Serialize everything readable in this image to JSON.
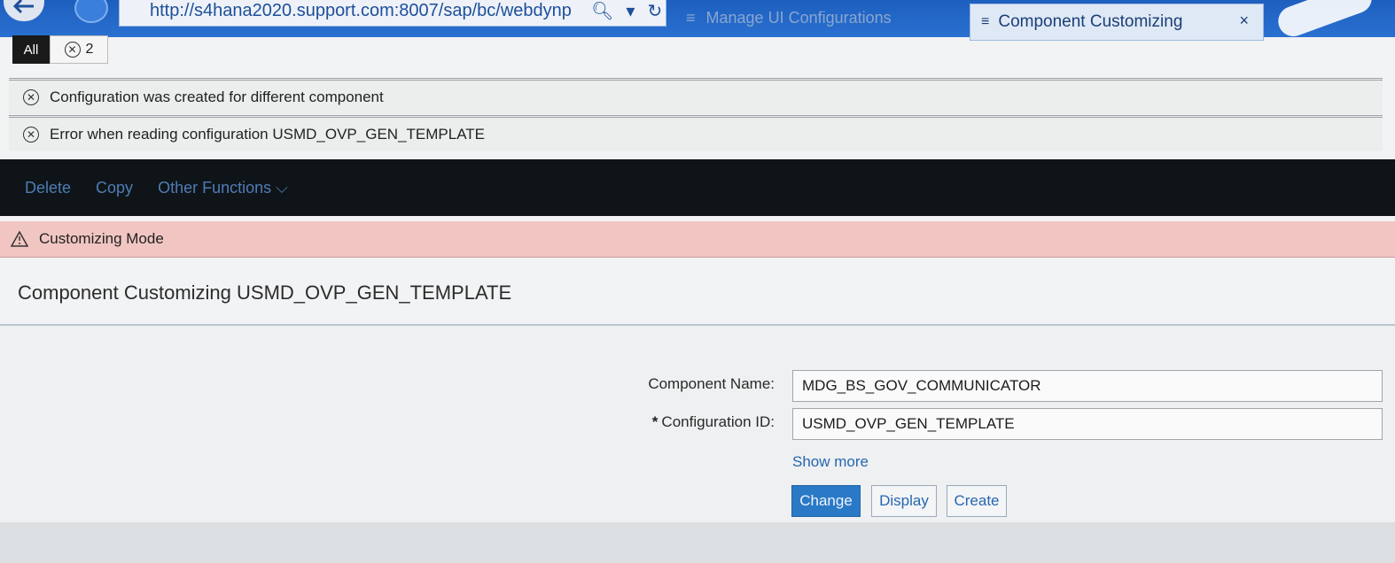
{
  "browser": {
    "address": "http://s4hana2020.support.com:8007/sap/bc/webdynp",
    "inactive_tab": "Manage UI Configurations",
    "active_tab": "Component Customizing",
    "active_tab_close": "×"
  },
  "messages": {
    "filter_all": "All",
    "error_count": "2",
    "items": [
      {
        "text": "Configuration was created for different component"
      },
      {
        "text": "Error when reading configuration USMD_OVP_GEN_TEMPLATE"
      }
    ]
  },
  "toolbar": {
    "delete_label": "Delete",
    "copy_label": "Copy",
    "other_functions_label": "Other Functions"
  },
  "mode_banner": {
    "text": "Customizing Mode"
  },
  "page": {
    "title": "Component Customizing USMD_OVP_GEN_TEMPLATE"
  },
  "form": {
    "component_name_label": "Component Name:",
    "component_name_value": "MDG_BS_GOV_COMMUNICATOR",
    "config_id_required": "*",
    "config_id_label": "Configuration ID:",
    "config_id_value": "USMD_OVP_GEN_TEMPLATE",
    "show_more": "Show more"
  },
  "buttons": {
    "change": "Change",
    "display": "Display",
    "create": "Create"
  }
}
